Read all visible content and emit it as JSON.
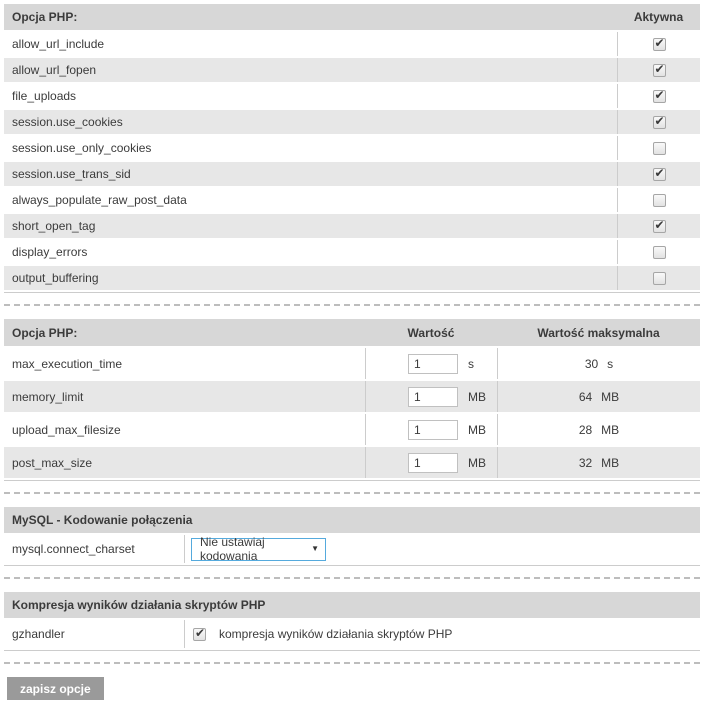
{
  "colors": {
    "header_bg": "#d7d7d7",
    "row_alt_bg": "#e7e7e7",
    "row_bg": "#ffffff",
    "table_border": "#cccccc",
    "text": "#3b3b3b",
    "select_border": "#55aadd",
    "button_bg": "#9a9a9a",
    "button_text": "#ffffff"
  },
  "flags_table": {
    "header": {
      "option_label": "Opcja PHP:",
      "active_label": "Aktywna"
    },
    "rows": [
      {
        "name": "allow_url_include",
        "checked": true
      },
      {
        "name": "allow_url_fopen",
        "checked": true
      },
      {
        "name": "file_uploads",
        "checked": true
      },
      {
        "name": "session.use_cookies",
        "checked": true
      },
      {
        "name": "session.use_only_cookies",
        "checked": false
      },
      {
        "name": "session.use_trans_sid",
        "checked": true
      },
      {
        "name": "always_populate_raw_post_data",
        "checked": false
      },
      {
        "name": "short_open_tag",
        "checked": true
      },
      {
        "name": "display_errors",
        "checked": false
      },
      {
        "name": "output_buffering",
        "checked": false
      }
    ]
  },
  "limits_table": {
    "header": {
      "option_label": "Opcja PHP:",
      "value_label": "Wartość",
      "max_label": "Wartość maksymalna"
    },
    "rows": [
      {
        "name": "max_execution_time",
        "value": "1",
        "unit": "s",
        "max_value": "30",
        "max_unit": "s"
      },
      {
        "name": "memory_limit",
        "value": "1",
        "unit": "MB",
        "max_value": "64",
        "max_unit": "MB"
      },
      {
        "name": "upload_max_filesize",
        "value": "1",
        "unit": "MB",
        "max_value": "28",
        "max_unit": "MB"
      },
      {
        "name": "post_max_size",
        "value": "1",
        "unit": "MB",
        "max_value": "32",
        "max_unit": "MB"
      }
    ]
  },
  "mysql_section": {
    "title": "MySQL - Kodowanie połączenia",
    "option_name": "mysql.connect_charset",
    "select_value": "Nie ustawiaj kodowania",
    "dropdown_arrow": "▼"
  },
  "compression_section": {
    "title": "Kompresja wyników działania skryptów PHP",
    "option_name": "gzhandler",
    "checkbox_checked": true,
    "checkbox_label": "kompresja wyników działania skryptów PHP"
  },
  "footer": {
    "save_button_label": "zapisz opcje"
  }
}
